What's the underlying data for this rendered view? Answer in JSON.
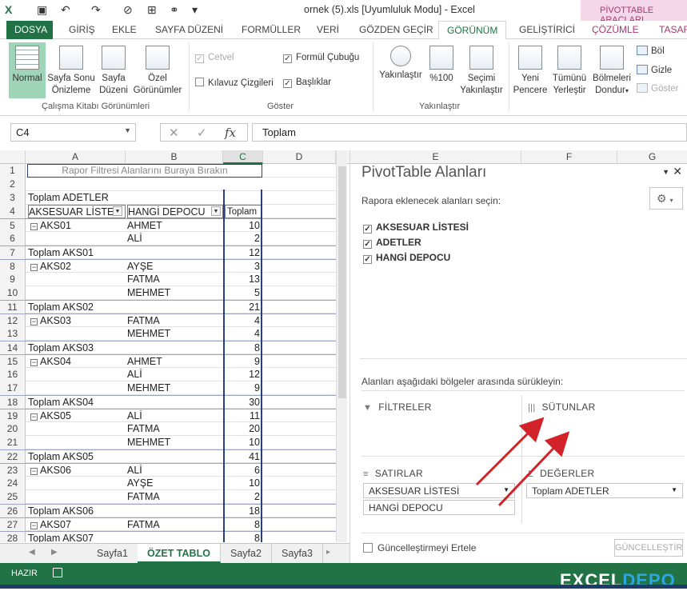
{
  "window": {
    "title": "ornek (5).xls  [Uyumluluk Modu] - Excel",
    "context_tab_group": "PİVOTTABLE ARAÇLARI"
  },
  "tabs": [
    {
      "label": "DOSYA"
    },
    {
      "label": "GİRİŞ"
    },
    {
      "label": "EKLE"
    },
    {
      "label": "SAYFA DÜZENİ"
    },
    {
      "label": "FORMÜLLER"
    },
    {
      "label": "VERİ"
    },
    {
      "label": "GÖZDEN GEÇİR"
    },
    {
      "label": "GÖRÜNÜM"
    },
    {
      "label": "GELİŞTİRİCİ"
    },
    {
      "label": "ÇÖZÜMLE"
    },
    {
      "label": "TASAR"
    }
  ],
  "ribbon": {
    "workbook_views": {
      "normal": "Normal",
      "page_break_1": "Sayfa Sonu",
      "page_break_2": "Önizleme",
      "page_layout_1": "Sayfa",
      "page_layout_2": "Düzeni",
      "custom_views_1": "Özel",
      "custom_views_2": "Görünümler",
      "group_label": "Çalışma Kitabı Görünümleri"
    },
    "show": {
      "ruler": "Cetvel",
      "formula_bar": "Formül Çubuğu",
      "gridlines": "Kılavuz Çizgileri",
      "headings": "Başlıklar",
      "group_label": "Göster"
    },
    "zoom": {
      "zoom": "Yakınlaştır",
      "zoom100": "%100",
      "zoom_sel_1": "Seçimi",
      "zoom_sel_2": "Yakınlaştır",
      "group_label": "Yakınlaştır"
    },
    "window": {
      "new_1": "Yeni",
      "new_2": "Pencere",
      "arrange_1": "Tümünü",
      "arrange_2": "Yerleştir",
      "freeze_1": "Bölmeleri",
      "freeze_2": "Dondur",
      "split": "Böl",
      "hide": "Gizle",
      "unhide": "Göster"
    }
  },
  "formula_bar": {
    "name_box": "C4",
    "formula": "Toplam"
  },
  "grid": {
    "columns": [
      "A",
      "B",
      "C",
      "D"
    ],
    "filter_area": "Rapor Filtresi Alanlarını Buraya Bırakın",
    "table_title": "Toplam ADETLER",
    "header": {
      "a": "AKSESUAR LİSTESİ",
      "b": "HANGİ DEPOCU",
      "c": "Toplam"
    },
    "rows": [
      {
        "n": "1"
      },
      {
        "n": "2"
      },
      {
        "n": "3"
      },
      {
        "n": "4"
      },
      {
        "n": "5",
        "a": "AKS01",
        "b": "AHMET",
        "c": "10"
      },
      {
        "n": "6",
        "b": "ALİ",
        "c": "2"
      },
      {
        "n": "7",
        "a": "Toplam AKS01",
        "c": "12"
      },
      {
        "n": "8",
        "a": "AKS02",
        "b": "AYŞE",
        "c": "3"
      },
      {
        "n": "9",
        "b": "FATMA",
        "c": "13"
      },
      {
        "n": "10",
        "b": "MEHMET",
        "c": "5"
      },
      {
        "n": "11",
        "a": "Toplam AKS02",
        "c": "21"
      },
      {
        "n": "12",
        "a": "AKS03",
        "b": "FATMA",
        "c": "4"
      },
      {
        "n": "13",
        "b": "MEHMET",
        "c": "4"
      },
      {
        "n": "14",
        "a": "Toplam AKS03",
        "c": "8"
      },
      {
        "n": "15",
        "a": "AKS04",
        "b": "AHMET",
        "c": "9"
      },
      {
        "n": "16",
        "b": "ALİ",
        "c": "12"
      },
      {
        "n": "17",
        "b": "MEHMET",
        "c": "9"
      },
      {
        "n": "18",
        "a": "Toplam AKS04",
        "c": "30"
      },
      {
        "n": "19",
        "a": "AKS05",
        "b": "ALİ",
        "c": "11"
      },
      {
        "n": "20",
        "b": "FATMA",
        "c": "20"
      },
      {
        "n": "21",
        "b": "MEHMET",
        "c": "10"
      },
      {
        "n": "22",
        "a": "Toplam AKS05",
        "c": "41"
      },
      {
        "n": "23",
        "a": "AKS06",
        "b": "ALİ",
        "c": "6"
      },
      {
        "n": "24",
        "b": "AYŞE",
        "c": "10"
      },
      {
        "n": "25",
        "b": "FATMA",
        "c": "2"
      },
      {
        "n": "26",
        "a": "Toplam AKS06",
        "c": "18"
      },
      {
        "n": "27",
        "a": "AKS07",
        "b": "FATMA",
        "c": "8"
      },
      {
        "n": "28",
        "a": "Toplam AKS07",
        "c": "8"
      }
    ]
  },
  "sheets": [
    "Sayfa1",
    "ÖZET TABLO",
    "Sayfa2",
    "Sayfa3"
  ],
  "pivot_pane": {
    "columns": [
      "E",
      "F",
      "G"
    ],
    "title": "PivotTable Alanları",
    "choose_fields": "Rapora eklenecek alanları seçin:",
    "fields": [
      "AKSESUAR LİSTESİ",
      "ADETLER",
      "HANGİ DEPOCU"
    ],
    "drag_hint": "Alanları aşağıdaki bölgeler arasında sürükleyin:",
    "filters": "FİLTRELER",
    "columns_area": "SÜTUNLAR",
    "rows_area": "SATIRLAR",
    "values_area": "DEĞERLER",
    "rows_items": [
      "AKSESUAR LİSTESİ",
      "HANGİ DEPOCU"
    ],
    "values_items": [
      "Toplam ADETLER"
    ],
    "defer": "Güncelleştirmeyi Ertele",
    "update": "GÜNCELLEŞTİR"
  },
  "status": {
    "ready": "HAZIR",
    "watermark_1": "EXCEL",
    "watermark_2": "DEPO"
  }
}
